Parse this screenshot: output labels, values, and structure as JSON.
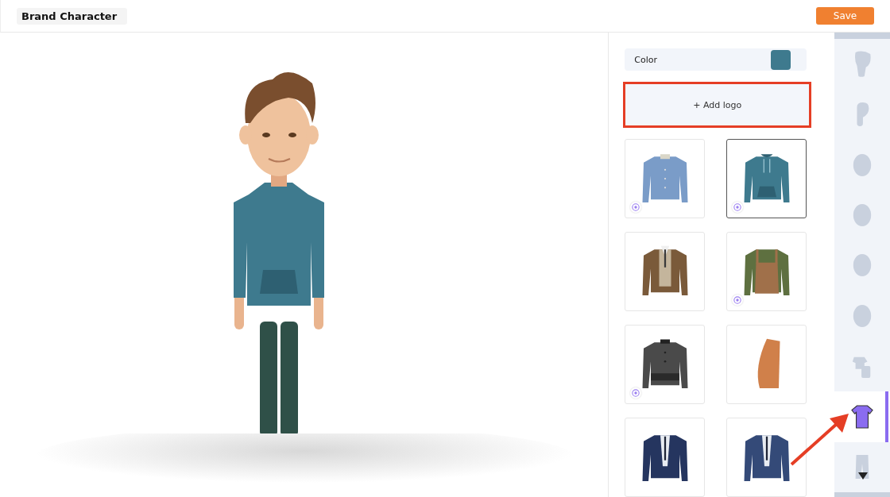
{
  "title": "Brand Character",
  "save_button": "Save",
  "color_field": {
    "label": "Color"
  },
  "add_logo": {
    "label": "+ Add logo",
    "highlighted": true
  },
  "outfits": [
    {
      "kind": "shirt",
      "color": "#7a9cc8",
      "selected": false,
      "badge": true
    },
    {
      "kind": "hoodie",
      "color": "#3e7a8e",
      "selected": true,
      "badge": true
    },
    {
      "kind": "blazer",
      "color": "#7a5a3a",
      "selected": false,
      "badge": false
    },
    {
      "kind": "overalls",
      "color": "#5e7040",
      "selected": false,
      "badge": true
    },
    {
      "kind": "jacket",
      "color": "#4a4a4a",
      "selected": false,
      "badge": true
    },
    {
      "kind": "drape",
      "color": "#d0804a",
      "selected": false,
      "badge": false
    },
    {
      "kind": "suit",
      "color": "#25355f",
      "selected": false,
      "badge": false
    },
    {
      "kind": "suit",
      "color": "#344a78",
      "selected": false,
      "badge": false
    }
  ],
  "categories": [
    {
      "kind": "hair",
      "selected": false,
      "pointed": false
    },
    {
      "kind": "ear",
      "selected": false,
      "pointed": false
    },
    {
      "kind": "brows",
      "selected": false,
      "pointed": false
    },
    {
      "kind": "eyes",
      "selected": false,
      "pointed": false
    },
    {
      "kind": "nose",
      "selected": false,
      "pointed": false
    },
    {
      "kind": "cheeks",
      "selected": false,
      "pointed": false
    },
    {
      "kind": "outfit",
      "selected": false,
      "pointed": false
    },
    {
      "kind": "top",
      "selected": true,
      "pointed": true
    },
    {
      "kind": "pants",
      "selected": false,
      "pointed": false
    }
  ]
}
